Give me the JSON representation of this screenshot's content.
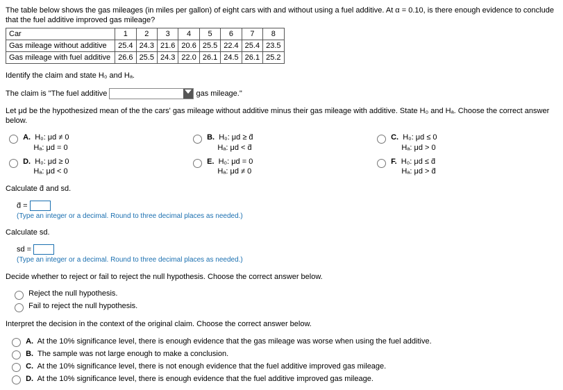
{
  "intro": "The table below shows the gas mileages (in miles per gallon) of eight cars with and without using a fuel additive. At α = 0.10, is there enough evidence to conclude that the fuel additive improved gas mileage?",
  "table": {
    "row_headers": [
      "Car",
      "Gas mileage without additive",
      "Gas mileage with fuel additive"
    ],
    "cols": [
      "1",
      "2",
      "3",
      "4",
      "5",
      "6",
      "7",
      "8"
    ],
    "without": [
      "25.4",
      "24.3",
      "21.6",
      "20.6",
      "25.5",
      "22.4",
      "25.4",
      "23.5"
    ],
    "with_add": [
      "26.6",
      "25.5",
      "24.3",
      "22.0",
      "26.1",
      "24.5",
      "26.1",
      "25.2"
    ]
  },
  "identify": "Identify the claim and state H₀ and Hₐ.",
  "claim_pre": "The claim is \"The fuel additive ",
  "claim_post": " gas mileage.\"",
  "let_line": "Let μd be the hypothesized mean of the the cars' gas mileage without additive minus their gas mileage with additive. State H₀ and Hₐ. Choose the correct answer below.",
  "opts": {
    "A": {
      "l": "A.",
      "h0": "H₀: μd ≠ 0",
      "ha": "Hₐ: μd = 0"
    },
    "B": {
      "l": "B.",
      "h0": "H₀: μd ≥ d̄",
      "ha": "Hₐ: μd < d̄"
    },
    "C": {
      "l": "C.",
      "h0": "H₀: μd ≤ 0",
      "ha": "Hₐ: μd > 0"
    },
    "D": {
      "l": "D.",
      "h0": "H₀: μd ≥ 0",
      "ha": "Hₐ: μd < 0"
    },
    "E": {
      "l": "E.",
      "h0": "H₀: μd = 0",
      "ha": "Hₐ: μd ≠ 0"
    },
    "F": {
      "l": "F.",
      "h0": "H₀: μd ≤ d̄",
      "ha": "Hₐ: μd > d̄"
    }
  },
  "calc_d_sd": "Calculate d̄ and sd.",
  "dbar_label": "d̄ = ",
  "note1": "(Type an integer or a decimal. Round to three decimal places as needed.)",
  "calc_sd": "Calculate sd.",
  "sd_label": "sd = ",
  "note2": "(Type an integer or a decimal. Round to three decimal places as needed.)",
  "decide": "Decide whether to reject or fail to reject the null hypothesis. Choose the correct answer below.",
  "reject": "Reject the null hypothesis.",
  "fail": "Fail to reject the null hypothesis.",
  "interpret": "Interpret the decision in the context of the original claim. Choose the correct answer below.",
  "iA_l": "A.",
  "iA": "At the 10% significance level, there is enough evidence that the gas mileage was worse when using the fuel additive.",
  "iB_l": "B.",
  "iB": "The sample was not large enough to make a conclusion.",
  "iC_l": "C.",
  "iC": "At the 10% significance level, there is not enough evidence that the fuel additive improved gas mileage.",
  "iD_l": "D.",
  "iD": "At the 10% significance level, there is enough evidence that the fuel additive improved gas mileage."
}
